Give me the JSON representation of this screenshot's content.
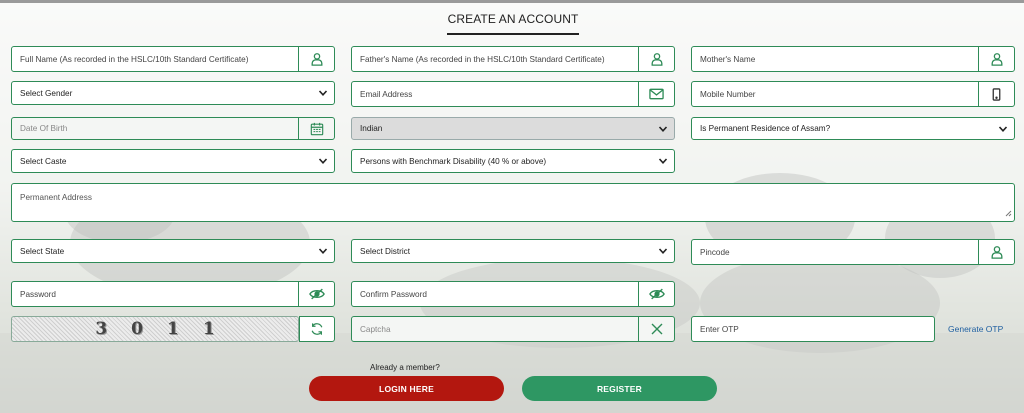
{
  "title": "CREATE AN ACCOUNT",
  "fields": {
    "full_name": "Full Name (As recorded in the HSLC/10th Standard Certificate)",
    "father_name": "Father's Name (As recorded in the HSLC/10th Standard Certificate)",
    "mother_name": "Mother's Name",
    "gender": "Select Gender",
    "email": "Email Address",
    "mobile": "Mobile Number",
    "dob": "Date Of Birth",
    "nationality": "Indian",
    "residence": "Is Permanent Residence of Assam?",
    "caste": "Select Caste",
    "disability": "Persons with Benchmark Disability (40 % or above)",
    "address": "Permanent Address",
    "state": "Select State",
    "district": "Select District",
    "pincode": "Pincode",
    "password": "Password",
    "confirm_password": "Confirm Password",
    "captcha_input": "Captcha",
    "otp": "Enter OTP"
  },
  "captcha_code": "3011",
  "generate_otp": "Generate OTP",
  "already_member": "Already a member?",
  "buttons": {
    "login": "LOGIN HERE",
    "register": "REGISTER"
  },
  "icons": {
    "user": "user-icon",
    "mail": "envelope-icon",
    "mobile": "mobile-phone-icon",
    "calendar": "calendar-icon",
    "eye": "eye-slash-icon",
    "refresh": "refresh-icon",
    "clear": "x-icon"
  },
  "colors": {
    "accent": "#2e8b57",
    "login": "#b3170f",
    "register": "#2e9763",
    "link": "#1f5fa0"
  }
}
